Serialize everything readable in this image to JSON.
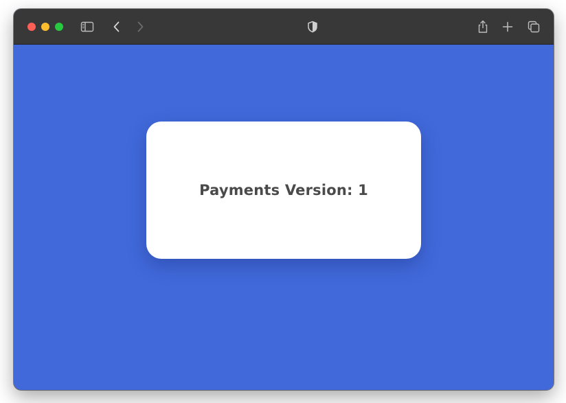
{
  "window": {
    "titlebar_color": "#383838",
    "traffic_lights": [
      "#fe5f57",
      "#febc2e",
      "#28c840"
    ],
    "toolbar_icons": [
      "sidebar-icon",
      "back-chevron-icon",
      "forward-chevron-icon",
      "shield-icon",
      "share-icon",
      "plus-icon",
      "tabs-overview-icon"
    ]
  },
  "page": {
    "background_color": "#4169d9",
    "card": {
      "text": "Payments Version: 1",
      "background_color": "#ffffff",
      "text_color": "#4a4a4a"
    }
  }
}
